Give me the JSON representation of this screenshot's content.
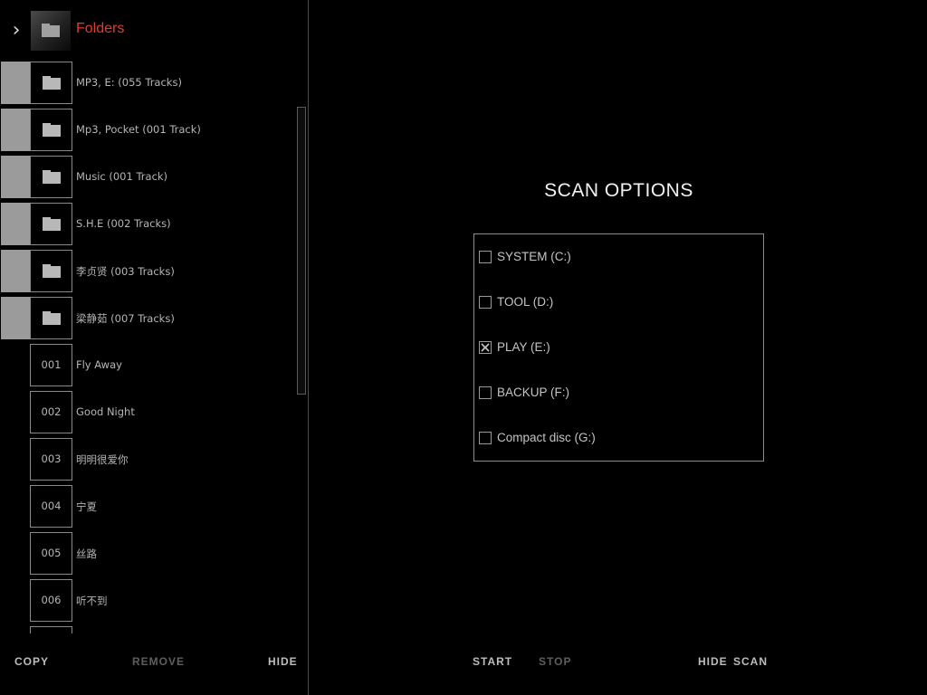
{
  "sidebar": {
    "title": "Folders",
    "folders": [
      {
        "label": "MP3, E: (055 Tracks)"
      },
      {
        "label": "Mp3, Pocket (001 Track)"
      },
      {
        "label": "Music (001 Track)"
      },
      {
        "label": "S.H.E (002 Tracks)"
      },
      {
        "label": "李贞贤 (003 Tracks)"
      },
      {
        "label": "梁静茹 (007 Tracks)"
      }
    ],
    "tracks": [
      {
        "number": "001",
        "title": "Fly Away"
      },
      {
        "number": "002",
        "title": "Good Night"
      },
      {
        "number": "003",
        "title": "明明很爱你"
      },
      {
        "number": "004",
        "title": "宁夏"
      },
      {
        "number": "005",
        "title": "丝路"
      },
      {
        "number": "006",
        "title": "听不到"
      }
    ],
    "footer": {
      "copy_label": "COPY",
      "remove_label": "REMOVE",
      "hide_label": "HIDE"
    }
  },
  "scan": {
    "title": "SCAN OPTIONS",
    "options": [
      {
        "label": "SYSTEM (C:)",
        "checked": false
      },
      {
        "label": "TOOL (D:)",
        "checked": false
      },
      {
        "label": "PLAY (E:)",
        "checked": true
      },
      {
        "label": "BACKUP (F:)",
        "checked": false
      },
      {
        "label": "Compact disc (G:)",
        "checked": false
      }
    ],
    "footer": {
      "start_label": "START",
      "stop_label": "STOP",
      "hide_label": "HIDE",
      "scan_label": "SCAN"
    }
  },
  "colors": {
    "accent": "#e23b2e",
    "background": "#000000",
    "tile_gray": "#9b9b9b"
  },
  "icons": {
    "toggle": "chevron-right-icon",
    "folder": "folder-icon",
    "check": "checkmark-x-icon"
  }
}
